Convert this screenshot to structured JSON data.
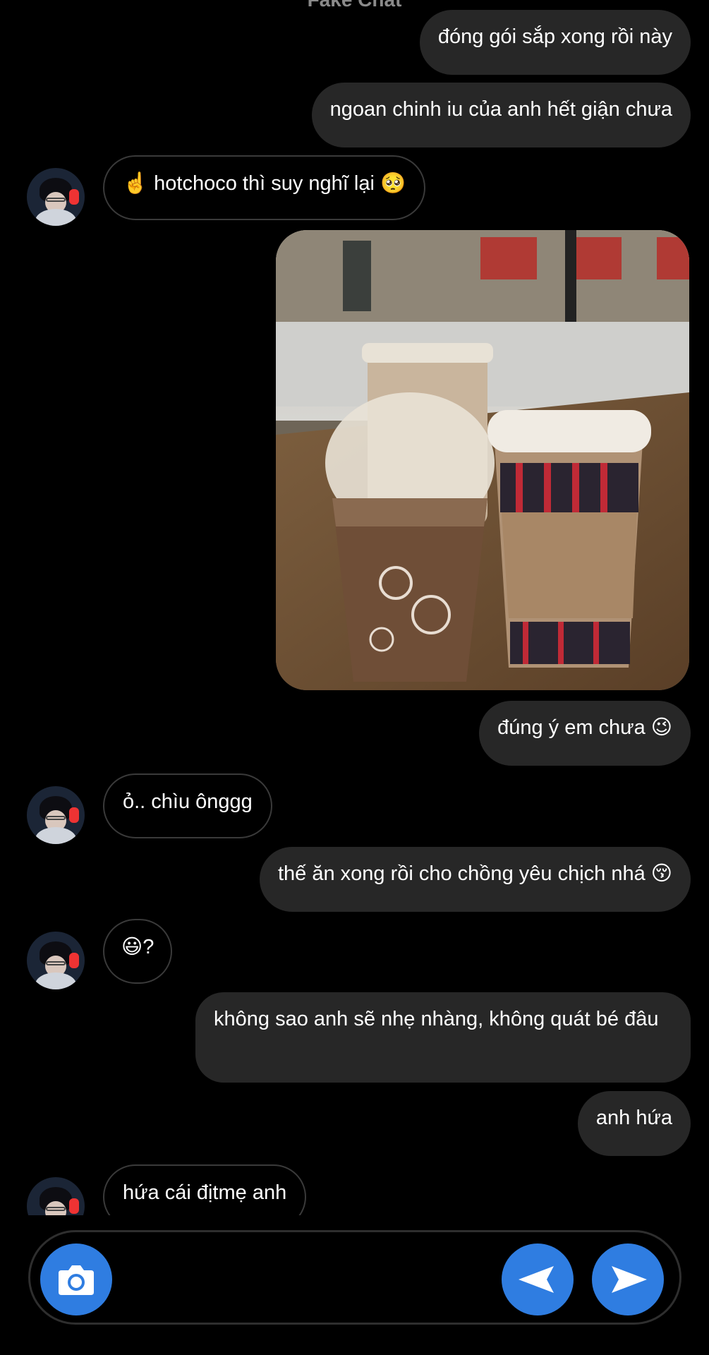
{
  "header": {
    "title": "Fake Chat"
  },
  "messages": [
    {
      "side": "out",
      "text": "đóng gói sắp xong rồi này"
    },
    {
      "side": "out",
      "text": "ngoan chinh iu của anh hết giận chưa"
    },
    {
      "side": "in",
      "text": "☝️ hotchoco thì suy nghĩ lại 🥺"
    },
    {
      "side": "out",
      "type": "image",
      "alt": "photo-of-starbucks-drinks"
    },
    {
      "side": "out",
      "text": "đúng ý em chưa 😉"
    },
    {
      "side": "in",
      "text": "ỏ.. chìu ônggg"
    },
    {
      "side": "out",
      "text": "thế ăn xong rồi cho chồng yêu chịch nhá 😚"
    },
    {
      "side": "in",
      "text": "😃?"
    },
    {
      "side": "out",
      "text": "không sao anh sẽ nhẹ nhàng, không quát bé đâu"
    },
    {
      "side": "out",
      "text": "anh hứa"
    },
    {
      "side": "in",
      "text": "hứa cái địtmẹ anh"
    }
  ],
  "composer": {
    "camera_icon": "camera-icon",
    "receive_icon": "send-left-icon",
    "send_icon": "send-right-icon"
  },
  "colors": {
    "background": "#000000",
    "outgoing_bubble": "#272727",
    "incoming_border": "#3a3a3a",
    "accent": "#2f7de1"
  }
}
